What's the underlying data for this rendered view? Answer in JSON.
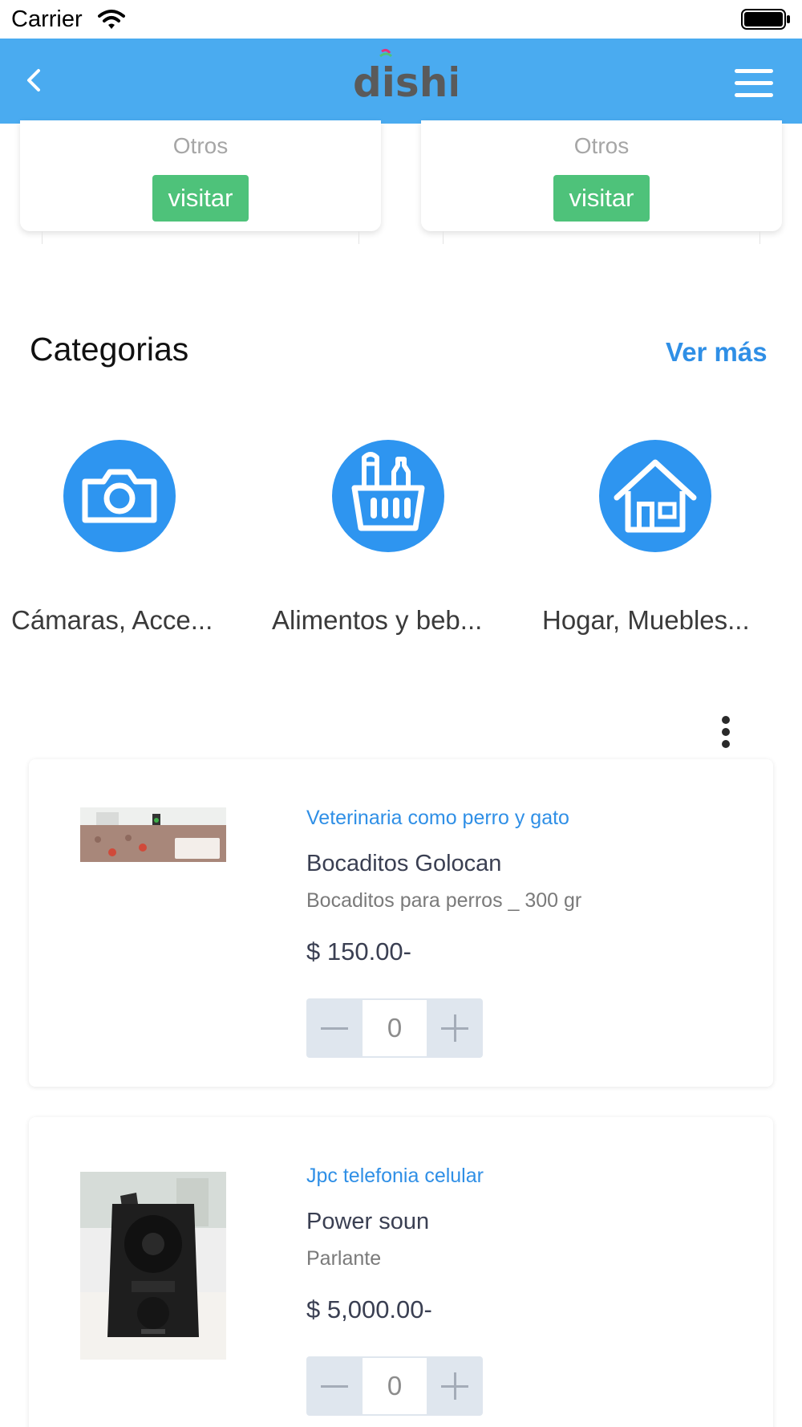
{
  "status_bar": {
    "carrier": "Carrier"
  },
  "header": {
    "logo_text": "dishi"
  },
  "store_cards": [
    {
      "category": "Otros",
      "button_label": "visitar"
    },
    {
      "category": "Otros",
      "button_label": "visitar"
    }
  ],
  "categories_section": {
    "title": "Categorias",
    "see_more": "Ver más",
    "items": [
      {
        "label": "Cámaras, Acce...",
        "icon": "camera-icon"
      },
      {
        "label": "Alimentos y beb...",
        "icon": "grocery-basket-icon"
      },
      {
        "label": "Hogar, Muebles...",
        "icon": "house-icon"
      }
    ]
  },
  "products": [
    {
      "store": "Veterinaria como perro y gato",
      "name": "Bocaditos Golocan",
      "description": "Bocaditos para perros _ 300 gr",
      "price": "$ 150.00-",
      "quantity": "0"
    },
    {
      "store": "Jpc telefonia celular",
      "name": "Power soun",
      "description": "Parlante",
      "price": "$ 5,000.00-",
      "quantity": "0"
    }
  ],
  "colors": {
    "header": "#4aabf0",
    "accent": "#2f8fe6",
    "visit_button": "#4ec27a",
    "category_circle": "#2e95f0"
  }
}
